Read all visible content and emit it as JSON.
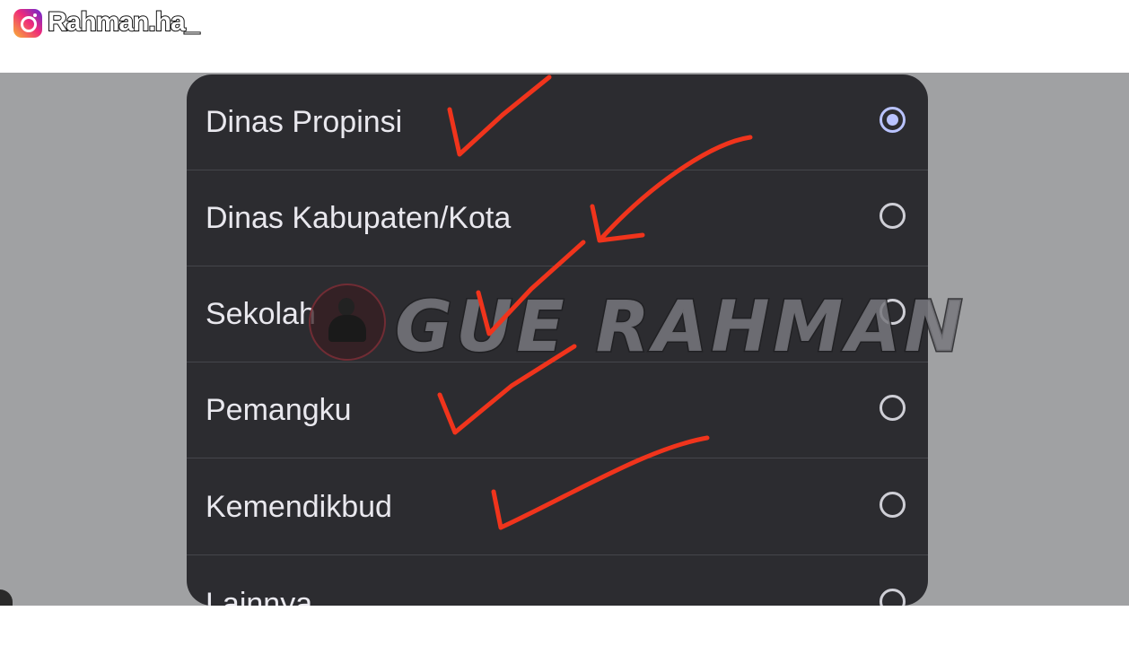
{
  "overlay": {
    "instagram_handle": "Rahman.ha_",
    "watermark_text": "GUE RAHMAN"
  },
  "dialog": {
    "options": [
      {
        "label": "Dinas Propinsi",
        "selected": true
      },
      {
        "label": "Dinas Kabupaten/Kota",
        "selected": false
      },
      {
        "label": "Sekolah",
        "selected": false
      },
      {
        "label": "Pemangku",
        "selected": false
      },
      {
        "label": "Kemendikbud",
        "selected": false
      },
      {
        "label": "Lainnya",
        "selected": false
      }
    ]
  },
  "colors": {
    "dialog_bg": "#2c2c30",
    "scrim": "#a0a1a3",
    "radio_selected": "#b9c3ff",
    "annotation_red": "#f0341c"
  }
}
